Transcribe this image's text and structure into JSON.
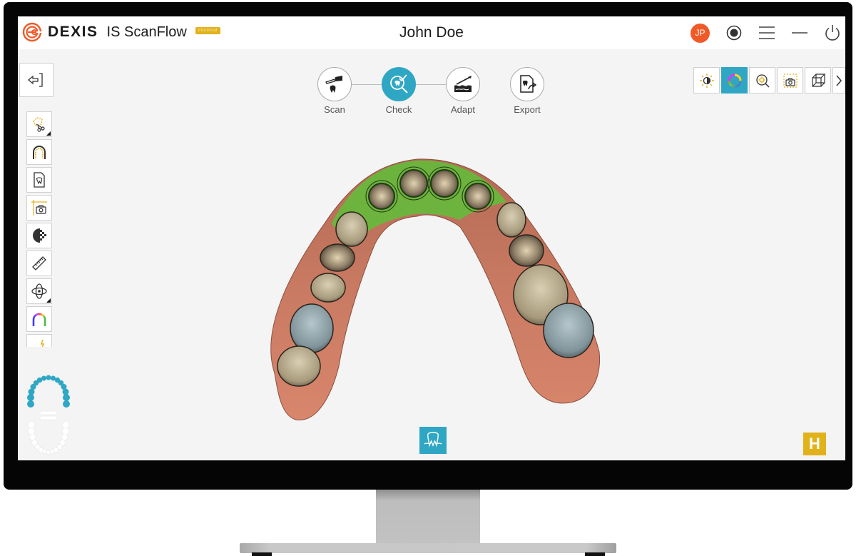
{
  "app": {
    "brand": "DEXIS",
    "product": "IS ScanFlow",
    "edition_badge": "PREMIUM",
    "accent_color": "#2fa7c4",
    "logo_color": "#ef5a28"
  },
  "header": {
    "patient_name": "John Doe",
    "user_initials": "JP",
    "icons": [
      "record-icon",
      "menu-icon",
      "minimize-icon",
      "power-icon"
    ]
  },
  "workflow": {
    "steps": [
      {
        "label": "Scan",
        "icon": "scanner-icon",
        "active": false
      },
      {
        "label": "Check",
        "icon": "check-tooth-icon",
        "active": true
      },
      {
        "label": "Adapt",
        "icon": "adapt-icon",
        "active": false
      },
      {
        "label": "Export",
        "icon": "export-icon",
        "active": false
      }
    ]
  },
  "view_toolbar": {
    "items": [
      {
        "name": "brightness-icon",
        "active": false
      },
      {
        "name": "color-wheel-icon",
        "active": true
      },
      {
        "name": "zoom-target-icon",
        "active": false
      },
      {
        "name": "snapshot-icon",
        "active": false
      },
      {
        "name": "wireframe-cube-icon",
        "active": false
      },
      {
        "name": "chevron-right-icon",
        "active": false
      }
    ]
  },
  "left_tools": {
    "exit_icon": "exit-icon",
    "items": [
      {
        "name": "lasso-cut-icon",
        "submenu": true
      },
      {
        "name": "arch-trim-icon",
        "submenu": false
      },
      {
        "name": "tooth-document-icon",
        "submenu": false
      },
      {
        "name": "camera-frame-icon",
        "submenu": false
      },
      {
        "name": "texture-toggle-icon",
        "submenu": false
      },
      {
        "name": "ruler-icon",
        "submenu": false
      },
      {
        "name": "rotate-orbit-icon",
        "submenu": true
      },
      {
        "name": "rainbow-arch-icon",
        "submenu": false
      },
      {
        "name": "tooth-flash-icon",
        "submenu": false
      }
    ]
  },
  "jaw_map": {
    "upper_selected": true,
    "lower_selected": false,
    "upper_color": "#2fa7c4"
  },
  "bottom": {
    "tooth_button_icon": "tooth-gum-icon",
    "h_badge": "H"
  }
}
